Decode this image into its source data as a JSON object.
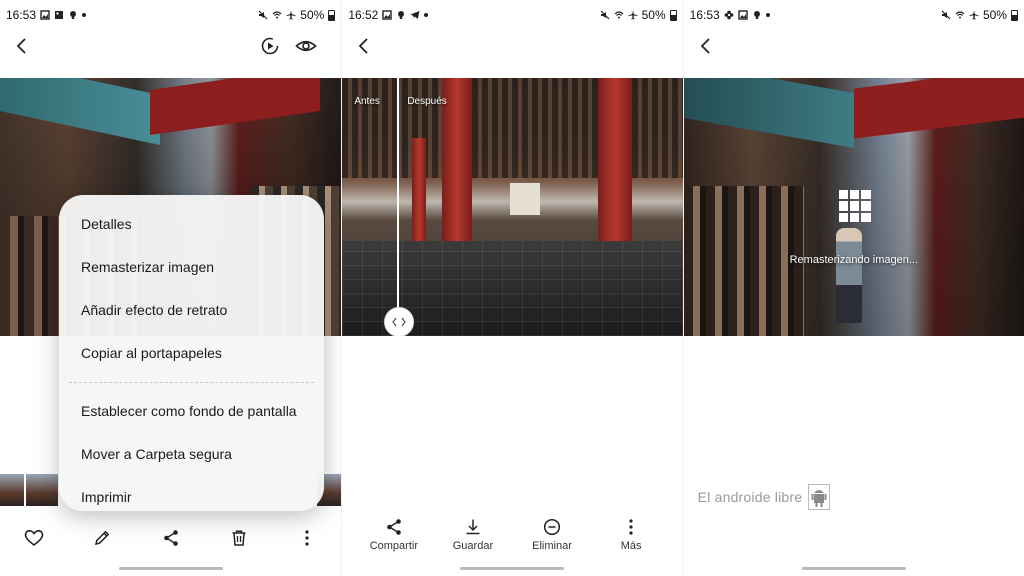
{
  "panels": [
    {
      "status": {
        "time": "16:53",
        "battery": "50%"
      },
      "menu": {
        "items": [
          "Detalles",
          "Remasterizar imagen",
          "Añadir efecto de retrato",
          "Copiar al portapapeles",
          "Establecer como fondo de pantalla",
          "Mover a Carpeta segura",
          "Imprimir"
        ]
      },
      "actions": [
        {
          "icon": "heart-icon"
        },
        {
          "icon": "edit-icon"
        },
        {
          "icon": "share-icon"
        },
        {
          "icon": "trash-icon"
        },
        {
          "icon": "more-icon"
        }
      ]
    },
    {
      "status": {
        "time": "16:52",
        "battery": "50%"
      },
      "compare": {
        "before": "Antes",
        "after": "Después"
      },
      "actions": [
        {
          "icon": "share-icon",
          "label": "Compartir"
        },
        {
          "icon": "download-icon",
          "label": "Guardar"
        },
        {
          "icon": "minus-circle-icon",
          "label": "Eliminar"
        },
        {
          "icon": "more-icon",
          "label": "Más"
        }
      ]
    },
    {
      "status": {
        "time": "16:53",
        "battery": "50%"
      },
      "progress": {
        "text": "Remasterizando imagen..."
      },
      "watermark": {
        "text": "El androide libre"
      }
    }
  ]
}
